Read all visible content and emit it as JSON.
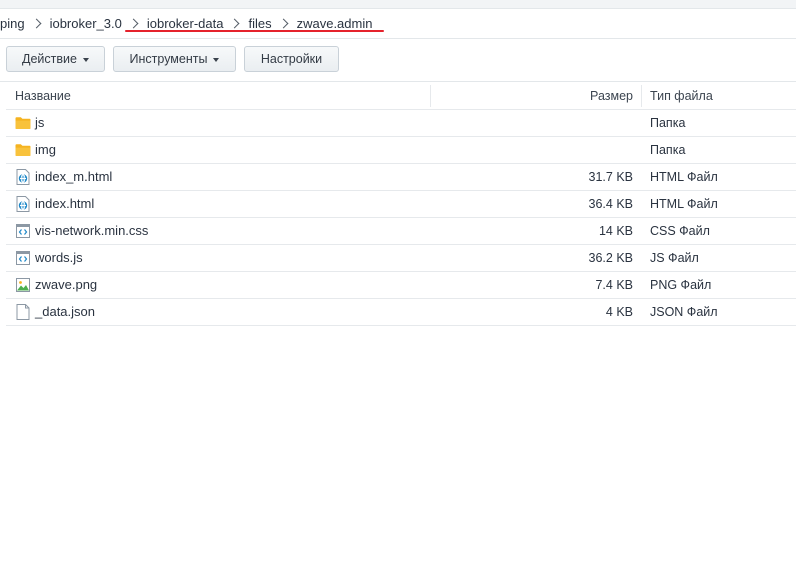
{
  "breadcrumb": {
    "items": [
      "ping",
      "iobroker_3.0",
      "iobroker-data",
      "files",
      "zwave.admin"
    ]
  },
  "toolbar": {
    "action_label": "Действие",
    "tools_label": "Инструменты",
    "settings_label": "Настройки"
  },
  "table": {
    "columns": {
      "name": "Название",
      "size": "Размер",
      "type": "Тип файла"
    },
    "rows": [
      {
        "name": "js",
        "size": "",
        "type": "Папка",
        "icon": "folder-icon"
      },
      {
        "name": "img",
        "size": "",
        "type": "Папка",
        "icon": "folder-icon"
      },
      {
        "name": "index_m.html",
        "size": "31.7 KB",
        "type": "HTML Файл",
        "icon": "html-file-icon"
      },
      {
        "name": "index.html",
        "size": "36.4 KB",
        "type": "HTML Файл",
        "icon": "html-file-icon"
      },
      {
        "name": "vis-network.min.css",
        "size": "14 KB",
        "type": "CSS Файл",
        "icon": "code-file-icon"
      },
      {
        "name": "words.js",
        "size": "36.2 KB",
        "type": "JS Файл",
        "icon": "code-file-icon"
      },
      {
        "name": "zwave.png",
        "size": "7.4 KB",
        "type": "PNG Файл",
        "icon": "image-file-icon"
      },
      {
        "name": "_data.json",
        "size": "4 KB",
        "type": "JSON Файл",
        "icon": "blank-file-icon"
      }
    ]
  },
  "colors": {
    "folder": "#f5b320",
    "accent_blue": "#1e88c8",
    "annotation_red": "#e5222c"
  }
}
